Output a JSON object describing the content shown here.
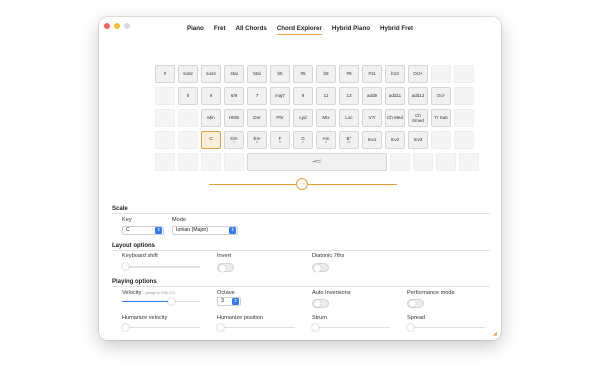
{
  "tabs": [
    "Piano",
    "Fret",
    "All Chords",
    "Chord Explorer",
    "Hybrid Piano",
    "Hybrid Fret"
  ],
  "active_tab": "Chord Explorer",
  "pads": {
    "row1": [
      "#",
      "sus2",
      "sus4",
      "4tal",
      "5tal",
      "b5",
      "#5",
      "b9",
      "#9",
      "#11",
      "b13",
      "Oct+"
    ],
    "row2": [
      "5",
      "6",
      "6/9",
      "7",
      "maj7",
      "9",
      "11",
      "13",
      "add9",
      "add11",
      "add13",
      "Oct-"
    ],
    "row3": [
      "Min",
      "HMin",
      "Dor",
      "Phr",
      "Lyd",
      "Mix",
      "Loc",
      "V7/",
      "Ch Med",
      "Ch Smed",
      "Tr Sub"
    ],
    "row4": [
      {
        "main": "C",
        "sub": "I"
      },
      {
        "main": "Dm",
        "sub": "ii"
      },
      {
        "main": "Em",
        "sub": "iii"
      },
      {
        "main": "F",
        "sub": "IV"
      },
      {
        "main": "G",
        "sub": "V"
      },
      {
        "main": "Am",
        "sub": "vi"
      },
      {
        "main": "B°",
        "sub": "vii°"
      },
      {
        "main": "Inv1",
        "sub": ""
      },
      {
        "main": "Inv2",
        "sub": ""
      },
      {
        "main": "Inv3",
        "sub": ""
      }
    ],
    "row5_label": "𝆒"
  },
  "settings": {
    "scale_title": "Scale",
    "key_label": "Key",
    "key_value": "C",
    "mode_label": "Mode",
    "mode_value": "Ionian (Major)",
    "layout_title": "Layout options",
    "keyboard_shift_label": "Keyboard shift",
    "invert_label": "Invert",
    "diatonic_label": "Diatonic 7ths",
    "playing_title": "Playing options",
    "velocity_label": "Velocity",
    "velocity_hint": "(assign to MIDI CC)",
    "octave_label": "Octave",
    "octave_value": "3",
    "auto_inversions_label": "Auto Inversions",
    "performance_label": "Performance mode",
    "humanize_velocity_label": "Humanize velocity",
    "humanize_position_label": "Humanize position",
    "strum_label": "Strum",
    "spread_label": "Spread"
  },
  "values": {
    "velocity": 0.63,
    "keyboard_shift": 0.0,
    "humanize_velocity": 0.0,
    "humanize_position": 0.0,
    "strum": 0.0,
    "spread": 0.0
  },
  "colors": {
    "accent": "#e8a13a",
    "control_blue": "#2f7cf6"
  }
}
